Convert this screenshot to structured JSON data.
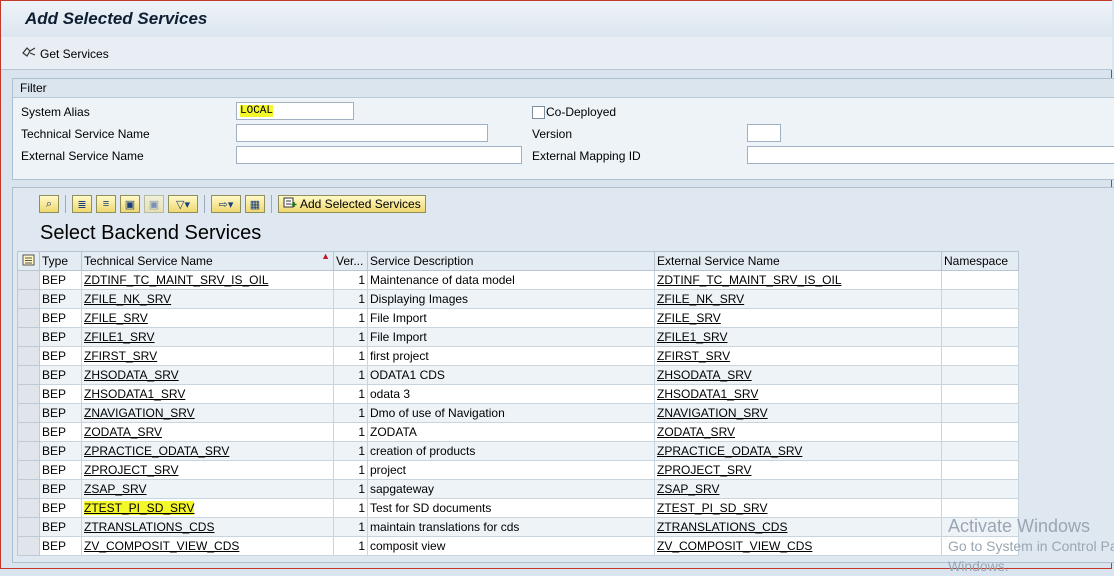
{
  "window": {
    "title": "Add Selected Services"
  },
  "toolbar": {
    "get_services": "Get Services"
  },
  "filter": {
    "header": "Filter",
    "system_alias_label": "System Alias",
    "system_alias_value": "LOCAL",
    "tech_name_label": "Technical Service Name",
    "ext_name_label": "External Service Name",
    "codeployed_label": "Co-Deployed",
    "version_label": "Version",
    "ext_mapping_label": "External Mapping ID"
  },
  "grid": {
    "add_selected": "Add Selected Services",
    "title": "Select Backend Services",
    "columns": [
      "Type",
      "Technical Service Name",
      "Ver...",
      "Service Description",
      "External Service Name",
      "Namespace"
    ],
    "rows": [
      {
        "type": "BEP",
        "tech": "ZDTINF_TC_MAINT_SRV_IS_OIL",
        "ver": "1",
        "desc": "Maintenance of data model",
        "ext": "ZDTINF_TC_MAINT_SRV_IS_OIL",
        "ns": ""
      },
      {
        "type": "BEP",
        "tech": "ZFILE_NK_SRV",
        "ver": "1",
        "desc": "Displaying Images",
        "ext": "ZFILE_NK_SRV",
        "ns": ""
      },
      {
        "type": "BEP",
        "tech": "ZFILE_SRV",
        "ver": "1",
        "desc": "File Import",
        "ext": "ZFILE_SRV",
        "ns": ""
      },
      {
        "type": "BEP",
        "tech": "ZFILE1_SRV",
        "ver": "1",
        "desc": "File Import",
        "ext": "ZFILE1_SRV",
        "ns": ""
      },
      {
        "type": "BEP",
        "tech": "ZFIRST_SRV",
        "ver": "1",
        "desc": "first project",
        "ext": "ZFIRST_SRV",
        "ns": ""
      },
      {
        "type": "BEP",
        "tech": "ZHSODATA_SRV",
        "ver": "1",
        "desc": "ODATA1 CDS",
        "ext": "ZHSODATA_SRV",
        "ns": ""
      },
      {
        "type": "BEP",
        "tech": "ZHSODATA1_SRV",
        "ver": "1",
        "desc": "odata 3",
        "ext": "ZHSODATA1_SRV",
        "ns": ""
      },
      {
        "type": "BEP",
        "tech": "ZNAVIGATION_SRV",
        "ver": "1",
        "desc": "Dmo of use of Navigation",
        "ext": "ZNAVIGATION_SRV",
        "ns": ""
      },
      {
        "type": "BEP",
        "tech": "ZODATA_SRV",
        "ver": "1",
        "desc": "ZODATA",
        "ext": "ZODATA_SRV",
        "ns": ""
      },
      {
        "type": "BEP",
        "tech": "ZPRACTICE_ODATA_SRV",
        "ver": "1",
        "desc": "creation of products",
        "ext": "ZPRACTICE_ODATA_SRV",
        "ns": ""
      },
      {
        "type": "BEP",
        "tech": "ZPROJECT_SRV",
        "ver": "1",
        "desc": "project",
        "ext": "ZPROJECT_SRV",
        "ns": ""
      },
      {
        "type": "BEP",
        "tech": "ZSAP_SRV",
        "ver": "1",
        "desc": "sapgateway",
        "ext": "ZSAP_SRV",
        "ns": ""
      },
      {
        "type": "BEP",
        "tech": "ZTEST_PI_SD_SRV",
        "ver": "1",
        "desc": "Test for SD documents",
        "ext": "ZTEST_PI_SD_SRV",
        "ns": ""
      },
      {
        "type": "BEP",
        "tech": "ZTRANSLATIONS_CDS",
        "ver": "1",
        "desc": "maintain translations for cds",
        "ext": "ZTRANSLATIONS_CDS",
        "ns": ""
      },
      {
        "type": "BEP",
        "tech": "ZV_COMPOSIT_VIEW_CDS",
        "ver": "1",
        "desc": "composit view",
        "ext": "ZV_COMPOSIT_VIEW_CDS",
        "ns": ""
      }
    ]
  },
  "watermark": {
    "line1": "Activate Windows",
    "line2": "Go to System in Control Panel",
    "line3": "Windows."
  }
}
